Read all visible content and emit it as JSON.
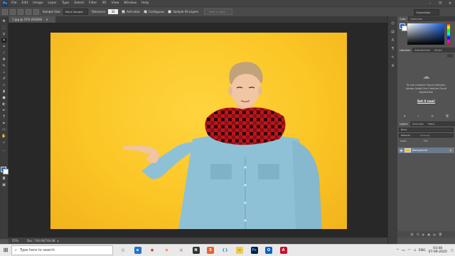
{
  "app": {
    "logo_text": "Ps",
    "menu": [
      "File",
      "Edit",
      "Image",
      "Layer",
      "Type",
      "Select",
      "Filter",
      "3D",
      "View",
      "Window",
      "Help"
    ],
    "window_controls": [
      "–",
      "❐",
      "✕"
    ]
  },
  "options_bar": {
    "sample_size_label": "Sample Size:",
    "sample_size_value": "Point Sample",
    "tolerance_label": "Tolerance:",
    "tolerance_value": "32",
    "anti_alias_label": "Anti-alias",
    "contiguous_label": "Contiguous",
    "sample_all_layers_label": "Sample All Layers",
    "refine_edge_label": "Refine Edge...",
    "workspace_value": "Essentials"
  },
  "document": {
    "tab_label": "1.jpg @ 25% (RGB/8)",
    "zoom": "25%",
    "doc_info": "Doc: 744.0K/744.0K"
  },
  "panels": {
    "color_tabs": [
      "Color",
      "Swatches"
    ],
    "library_tabs": [
      "Libraries",
      "Adjustments",
      "Styles"
    ],
    "library_message": "To use Creative Cloud Libraries, please install the Creative Cloud Application",
    "library_link": "Get it now!",
    "layers_tabs": [
      "Layers",
      "Channels",
      "Paths"
    ],
    "layers_kind": "Kind",
    "layers_blend": "Normal",
    "layers_opacity": "Opacity:",
    "layers_lock": "Lock:",
    "layers_fill": "Fill:",
    "layer_name": "Background",
    "layers_bottom_icons": [
      "⛓",
      "fx",
      "◐",
      "▣",
      "▤",
      "🗑"
    ]
  },
  "taskbar": {
    "search_placeholder": "Type here to search",
    "language": "ENG",
    "time": "03:48",
    "date": "07-09-2020",
    "apps": [
      {
        "name": "task-view-icon",
        "glyph": "○",
        "color": "#e9e9ea",
        "text_color": "#222"
      },
      {
        "name": "edge-icon",
        "glyph": "e",
        "color": "#1f75cc",
        "text_color": "#fff"
      },
      {
        "name": "chrome-icon",
        "glyph": "●",
        "color": "#e9e9ea",
        "text_color": "#db4437"
      },
      {
        "name": "firefox-icon",
        "glyph": "◉",
        "color": "#e9e9ea",
        "text_color": "#ff7139"
      },
      {
        "name": "photos-icon",
        "glyph": "◎",
        "color": "#e9e9ea",
        "text_color": "#b0237e"
      },
      {
        "name": "notion-icon",
        "glyph": "N",
        "color": "#333",
        "text_color": "#fff"
      },
      {
        "name": "sublime-icon",
        "glyph": "S",
        "color": "#e8612d",
        "text_color": "#fff"
      },
      {
        "name": "vscode-icon",
        "glyph": "❮❯",
        "color": "#e9e9ea",
        "text_color": "#1677c2"
      },
      {
        "name": "explorer-icon",
        "glyph": "▬",
        "color": "#f2c94c",
        "text_color": "#c79a2a"
      },
      {
        "name": "photoshop-icon",
        "glyph": "Ps",
        "color": "#0d1f3c",
        "text_color": "#31a8ff"
      },
      {
        "name": "outlook-icon",
        "glyph": "O",
        "color": "#0b63c5",
        "text_color": "#fff"
      },
      {
        "name": "acrobat-icon",
        "glyph": "A",
        "color": "#c8102e",
        "text_color": "#fff"
      }
    ]
  },
  "colors": {
    "ui_dark": "#535353",
    "canvas_bg": "#282828",
    "photo_bg": "#fbc626",
    "accent_blue": "#1a66cc"
  }
}
